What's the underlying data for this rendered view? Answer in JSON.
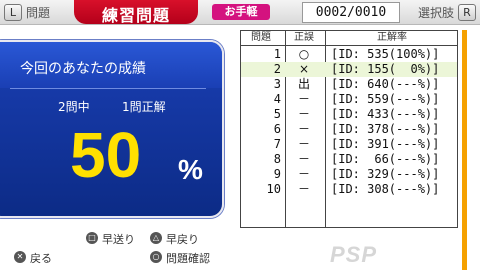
{
  "topbar": {
    "left_button": "L",
    "left_label": "問題",
    "title": "練習問題",
    "mode": "お手軽",
    "counter": "0002/0010",
    "right_label": "選択肢",
    "right_button": "R"
  },
  "score": {
    "title": "今回のあなたの成績",
    "questions": "2問中",
    "correct": "1問正解",
    "percent": "50",
    "percent_sign": "%"
  },
  "table": {
    "headers": [
      "問題",
      "正誤",
      "正解率"
    ],
    "rows": [
      {
        "no": "1",
        "mark": "○",
        "rate": "[ID: 535(100%)]"
      },
      {
        "no": "2",
        "mark": "×",
        "rate": "[ID: 155(  0%)]"
      },
      {
        "no": "3",
        "mark": "出",
        "rate": "[ID: 640(---%)]"
      },
      {
        "no": "4",
        "mark": "－",
        "rate": "[ID: 559(---%)]"
      },
      {
        "no": "5",
        "mark": "－",
        "rate": "[ID: 433(---%)]"
      },
      {
        "no": "6",
        "mark": "－",
        "rate": "[ID: 378(---%)]"
      },
      {
        "no": "7",
        "mark": "－",
        "rate": "[ID: 391(---%)]"
      },
      {
        "no": "8",
        "mark": "－",
        "rate": "[ID:  66(---%)]"
      },
      {
        "no": "9",
        "mark": "－",
        "rate": "[ID: 329(---%)]"
      },
      {
        "no": "10",
        "mark": "－",
        "rate": "[ID: 308(---%)]"
      }
    ],
    "highlighted_row": 2
  },
  "footer": {
    "square_label": "早送り",
    "triangle_label": "早戻り",
    "cross_label": "戻る",
    "circle_label": "問題確認"
  },
  "icons": {
    "square": "□",
    "triangle": "△",
    "cross": "✕",
    "circle": "○"
  },
  "logo": "PSP"
}
